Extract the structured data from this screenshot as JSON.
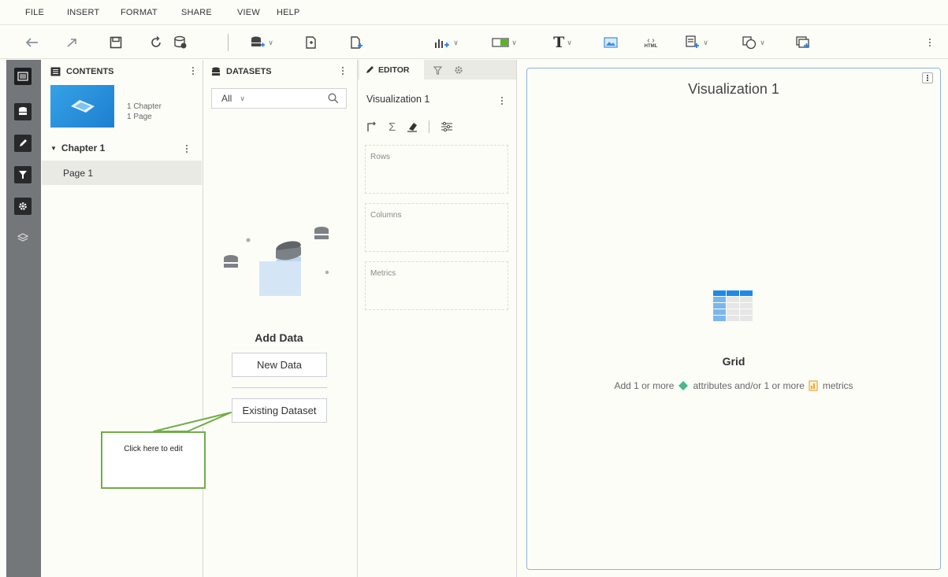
{
  "menu": [
    "FILE",
    "INSERT",
    "FORMAT",
    "SHARE",
    "VIEW",
    "HELP"
  ],
  "toolbar": {
    "icons": [
      "undo-icon",
      "redo-icon",
      "save-icon",
      "refresh-icon",
      "data-pause-icon",
      "add-data-icon",
      "duplicate-page-icon",
      "new-page-icon",
      "insert-visualization-icon",
      "insert-filter-icon",
      "insert-text-icon",
      "insert-image-icon",
      "insert-html-icon",
      "insert-panel-stack-icon",
      "insert-shape-icon",
      "insert-widget-icon",
      "more-icon"
    ],
    "html_label": "HTML"
  },
  "rail": {
    "icons": [
      "table-of-contents-icon",
      "datasets-icon",
      "editor-icon",
      "filter-icon",
      "settings-icon",
      "layers-icon"
    ]
  },
  "contents": {
    "title": "CONTENTS",
    "thumbnail": {
      "chapters": "1 Chapter",
      "pages": "1 Page"
    },
    "chapter": "Chapter 1",
    "page": "Page 1"
  },
  "datasets": {
    "title": "DATASETS",
    "filter_value": "All",
    "add_data": "Add Data",
    "new_data": "New Data",
    "existing_dataset": "Existing Dataset"
  },
  "editor": {
    "tab_label": "EDITOR",
    "viz_name": "Visualization 1",
    "zones": [
      "Rows",
      "Columns",
      "Metrics"
    ]
  },
  "canvas": {
    "title": "Visualization 1",
    "viz_type": "Grid",
    "hint_prefix": "Add 1 or more",
    "hint_attributes": "attributes and/or 1 or more",
    "hint_metrics": "metrics"
  },
  "callout": {
    "text": "Click here to edit"
  },
  "colors": {
    "accent_blue": "#8fb2d9",
    "attribute_green": "#4db88a",
    "metric_orange": "#e8a93a",
    "callout_green": "#70ad47",
    "rail_gray": "#74777a"
  }
}
